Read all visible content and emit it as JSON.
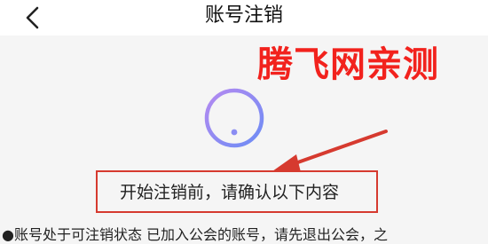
{
  "nav": {
    "title": "账号注销",
    "back_icon": "chevron-left-icon"
  },
  "watermark": {
    "text": "腾飞网亲测",
    "color": "#f2221d"
  },
  "notice": {
    "icon": "exclamation-circle-icon",
    "heading": "开始注销前，请确认以下内容",
    "items": [
      "●账号处于可注销状态 已加入公会的账号，请先退出公会，之"
    ]
  },
  "colors": {
    "icon_gradient_start": "#a686f2",
    "icon_gradient_end": "#6c8cf5",
    "annotation_red": "#d63a2f",
    "page_background": "#f5f5f5"
  }
}
